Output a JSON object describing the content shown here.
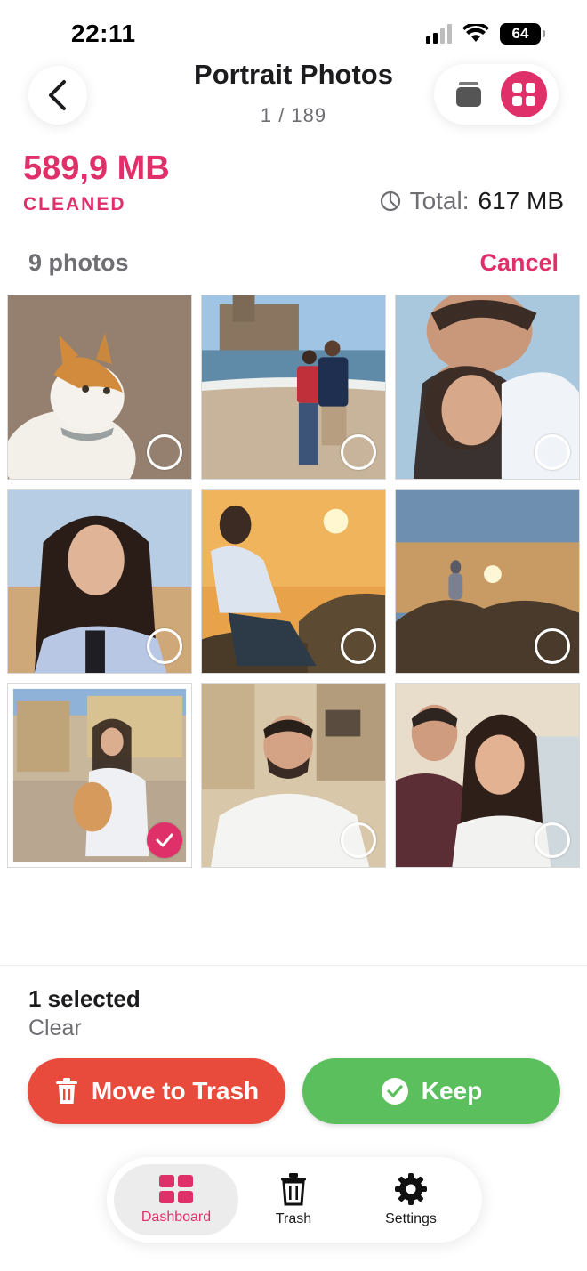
{
  "status_bar": {
    "time": "22:11",
    "battery": "64"
  },
  "header": {
    "title": "Portrait Photos",
    "counter": "1 / 189"
  },
  "stats": {
    "cleaned_amount": "589,9 MB",
    "cleaned_label": "CLEANED",
    "total_label": "Total:",
    "total_value": "617 MB"
  },
  "grid": {
    "count_label": "9 photos",
    "cancel_label": "Cancel",
    "photos": [
      {
        "subject": "cat",
        "selected": false
      },
      {
        "subject": "beach-couple",
        "selected": false
      },
      {
        "subject": "couple-selfie",
        "selected": false
      },
      {
        "subject": "woman-portrait",
        "selected": false
      },
      {
        "subject": "sunset-woman",
        "selected": false
      },
      {
        "subject": "sunset-rocks",
        "selected": false
      },
      {
        "subject": "woman-with-cat",
        "selected": true
      },
      {
        "subject": "man-portrait",
        "selected": false
      },
      {
        "subject": "couple-beach-selfie",
        "selected": false
      }
    ]
  },
  "selection": {
    "count_label": "1 selected",
    "clear_label": "Clear"
  },
  "actions": {
    "trash_label": "Move to Trash",
    "keep_label": "Keep"
  },
  "tabs": [
    {
      "label": "Dashboard",
      "icon": "dashboard-icon",
      "active": true
    },
    {
      "label": "Trash",
      "icon": "trash-icon",
      "active": false
    },
    {
      "label": "Settings",
      "icon": "gear-icon",
      "active": false
    }
  ],
  "colors": {
    "accent": "#e0306a",
    "trash": "#e84a3c",
    "keep": "#5cbf5e"
  }
}
